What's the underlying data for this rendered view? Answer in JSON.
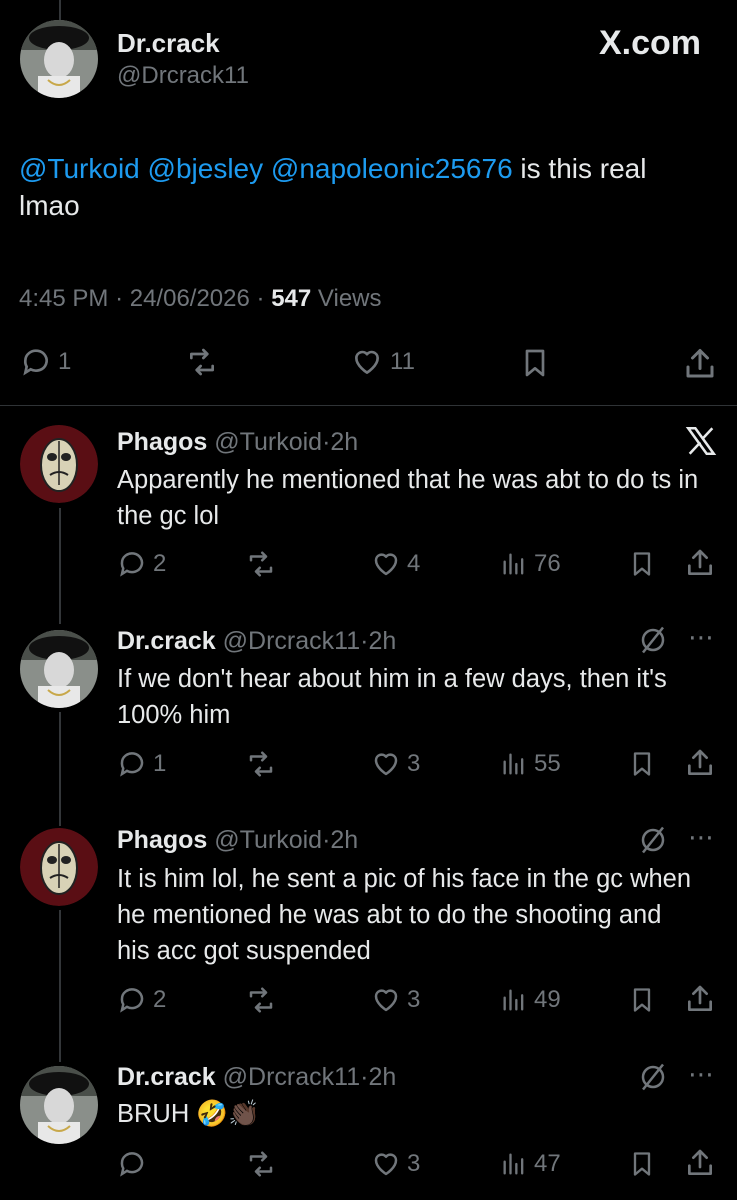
{
  "main_post": {
    "author_name": "Dr.crack",
    "handle": "@Drcrack11",
    "brand": "X.com",
    "mentions": [
      "@Turkoid",
      "@bjesley",
      "@napoleonic25676"
    ],
    "text_after": " is this real lmao",
    "time": "4:45 PM",
    "date": "24/06/2026",
    "views_count": "547",
    "views_label": " Views",
    "replies": "1",
    "likes": "11"
  },
  "replies": [
    {
      "author_name": "Phagos",
      "handle": "@Turkoid",
      "age": "2h",
      "text": "Apparently he mentioned that he was abt to do ts in the gc lol",
      "replies": "2",
      "likes": "4",
      "views": "76",
      "corner_icon": "x-logo-icon"
    },
    {
      "author_name": "Dr.crack",
      "handle": "@Drcrack11",
      "age": "2h",
      "text": "If we don't hear about him in a few days, then it's 100% him",
      "replies": "1",
      "likes": "3",
      "views": "55",
      "corner_icon": "grok-icon"
    },
    {
      "author_name": "Phagos",
      "handle": "@Turkoid",
      "age": "2h",
      "text": "It is him lol, he sent a pic of his face in the gc when he mentioned he was abt to do the shooting and his acc got suspended",
      "replies": "2",
      "likes": "3",
      "views": "49",
      "corner_icon": "grok-icon"
    },
    {
      "author_name": "Dr.crack",
      "handle": "@Drcrack11",
      "age": "2h",
      "text": "BRUH 🤣👏🏿",
      "replies": "",
      "likes": "3",
      "views": "47",
      "corner_icon": "grok-icon"
    }
  ],
  "separator": "·",
  "colors": {
    "background": "#000000",
    "text": "#e7e9ea",
    "secondary": "#71767b",
    "link": "#1d9bf0",
    "divider": "#2f3336"
  }
}
